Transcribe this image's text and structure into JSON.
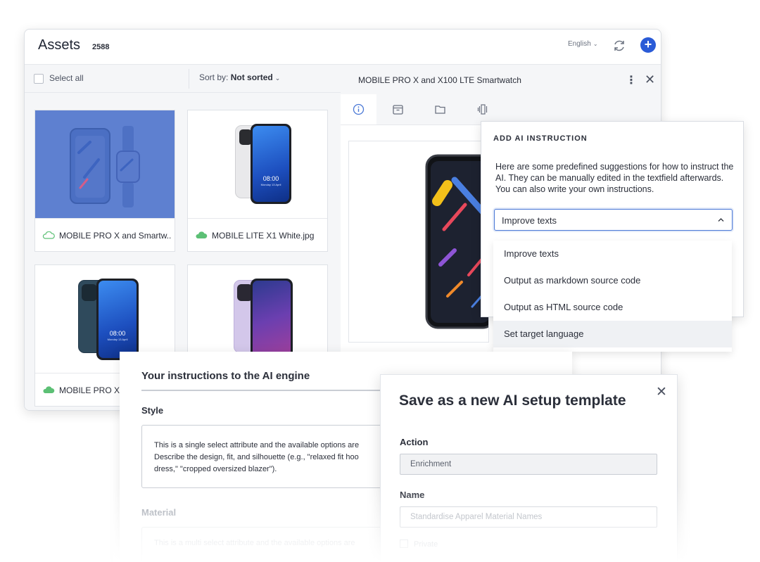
{
  "assets": {
    "title": "Assets",
    "count": "2588",
    "language": "English",
    "toolbar": {
      "select_all": "Select all",
      "sort_prefix": "Sort by:",
      "sort_value": "Not sorted"
    },
    "cards": [
      {
        "name": "MOBILE PRO X and Smartw...",
        "cloud": "outline"
      },
      {
        "name": "MOBILE LITE X1 White.jpg",
        "cloud": "filled"
      },
      {
        "name": "MOBILE PRO X I",
        "cloud": "filled"
      },
      {
        "name": "",
        "cloud": ""
      }
    ],
    "phone_clock": "08:00",
    "phone_date": "Monday 13 April"
  },
  "detail": {
    "title": "MOBILE PRO X and X100 LTE Smartwatch",
    "tabs": [
      "info-icon",
      "archive-icon",
      "folder-icon",
      "channels-icon"
    ]
  },
  "ai_popup": {
    "heading": "ADD AI INSTRUCTION",
    "description": "Here are some predefined suggestions for how to instruct the AI. They can be manually edited in the textfield afterwards. You can also write your own instructions.",
    "selected": "Improve texts",
    "options": [
      "Improve texts",
      "Output as markdown source code",
      "Output as HTML source code",
      "Set target language"
    ]
  },
  "instructions": {
    "title": "Your instructions to the AI engine",
    "style_label": "Style",
    "style_text": "This is a single select attribute and the available options are\nDescribe the design, fit, and silhouette (e.g., \"relaxed fit hoo\ndress,\" \"cropped oversized blazer\").",
    "material_label": "Material",
    "material_text": "This is a multi select attribute and the available options are"
  },
  "save_dialog": {
    "title": "Save as a new AI setup template",
    "action_label": "Action",
    "action_value": "Enrichment",
    "name_label": "Name",
    "name_placeholder": "Standardise Apparel Material Names",
    "private_label": "Private"
  },
  "colors": {
    "accent": "#2a5bd7",
    "selected_card": "#5e80d0",
    "cloud_green": "#5cc075"
  }
}
